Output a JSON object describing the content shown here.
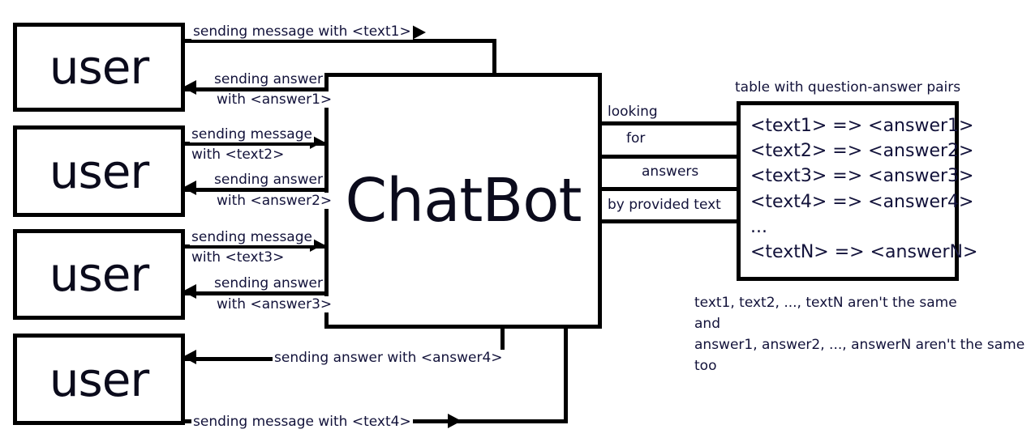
{
  "diagram": {
    "title": "ChatBot message flow diagram",
    "colors": {
      "stroke": "#000000",
      "text": "#12123a",
      "background": "#ffffff"
    },
    "chatbot": {
      "label": "ChatBot"
    },
    "users": [
      {
        "label": "user"
      },
      {
        "label": "user"
      },
      {
        "label": "user"
      },
      {
        "label": "user"
      }
    ],
    "flows": [
      {
        "request_line1": "sending message with <text1>",
        "request_line2": "",
        "response_line1": "sending answer",
        "response_line2": "with <answer1>"
      },
      {
        "request_line1": "sending message",
        "request_line2": "with <text2>",
        "response_line1": "sending answer",
        "response_line2": "with <answer2>"
      },
      {
        "request_line1": "sending message",
        "request_line2": "with <text3>",
        "response_line1": "sending answer",
        "response_line2": "with <answer3>"
      },
      {
        "request_line1": "sending message with <text4>",
        "request_line2": "",
        "response_line1": "sending answer with <answer4>",
        "response_line2": ""
      }
    ],
    "lookup": {
      "line1": "looking",
      "line2": "for",
      "line3": "answers",
      "line4": "by provided text"
    },
    "table": {
      "caption": "table with question-answer pairs",
      "rows": [
        "<text1> => <answer1>",
        "<text2> => <answer2>",
        "<text3> => <answer3>",
        "<text4> => <answer4>",
        "...",
        "<textN> => <answerN>"
      ]
    },
    "note": {
      "line1": "text1, text2, ..., textN aren't the same",
      "line2": "and",
      "line3": "answer1, answer2, ..., answerN aren't the same",
      "line4": "too"
    }
  }
}
